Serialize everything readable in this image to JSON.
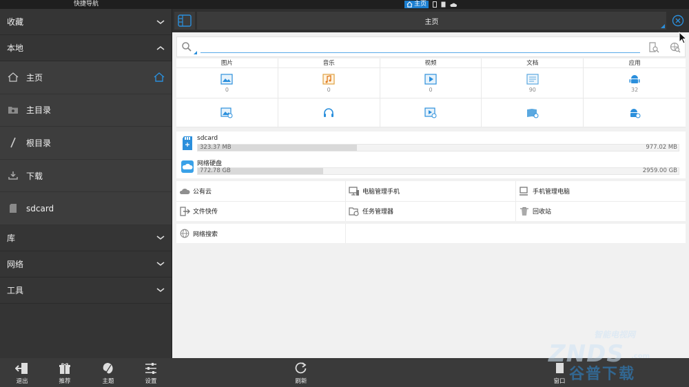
{
  "status_bar": {
    "left_title": "快捷导航",
    "active_tab": "主页"
  },
  "sidebar": {
    "sections_top": [
      {
        "label": "收藏",
        "expanded": false
      },
      {
        "label": "本地",
        "expanded": true
      }
    ],
    "local_items": [
      {
        "label": "主页",
        "icon": "home-icon",
        "active": true
      },
      {
        "label": "主目录",
        "icon": "folder-icon"
      },
      {
        "label": "根目录",
        "icon": "slash-icon"
      },
      {
        "label": "下载",
        "icon": "download-icon"
      },
      {
        "label": "sdcard",
        "icon": "sdcard-icon"
      }
    ],
    "sections_bottom": [
      {
        "label": "库"
      },
      {
        "label": "网络"
      },
      {
        "label": "工具"
      }
    ]
  },
  "bottom_bar": {
    "exit": "退出",
    "recommend": "推荐",
    "theme": "主题",
    "settings": "设置",
    "refresh": "刷新",
    "window": "窗口"
  },
  "main": {
    "title": "主页",
    "search": {
      "value": "",
      "placeholder": ""
    },
    "categories": [
      {
        "label": "图片",
        "count": "0",
        "icon": "image-icon"
      },
      {
        "label": "音乐",
        "count": "0",
        "icon": "music-icon"
      },
      {
        "label": "视频",
        "count": "0",
        "icon": "video-icon"
      },
      {
        "label": "文档",
        "count": "90",
        "icon": "document-icon"
      },
      {
        "label": "应用",
        "count": "32",
        "icon": "android-icon"
      }
    ],
    "storage": [
      {
        "name": "sdcard",
        "used": "323.37 MB",
        "total": "977.02 MB",
        "fill_fraction": 0.331,
        "icon": "sdcard-icon"
      },
      {
        "name": "网络硬盘",
        "used": "772.78 GB",
        "total": "2959.00 GB",
        "fill_fraction": 0.261,
        "icon": "cloud-drive-icon"
      }
    ],
    "tools": [
      {
        "label": "公有云",
        "icon": "cloud-icon"
      },
      {
        "label": "电脑管理手机",
        "icon": "pc-manage-phone-icon"
      },
      {
        "label": "手机管理电脑",
        "icon": "phone-manage-pc-icon"
      },
      {
        "label": "文件快传",
        "icon": "file-transfer-icon"
      },
      {
        "label": "任务管理器",
        "icon": "task-manager-icon"
      },
      {
        "label": "回收站",
        "icon": "trash-icon"
      }
    ],
    "net_search": {
      "label": "网络搜索",
      "icon": "globe-icon"
    }
  },
  "watermark": {
    "line1": "智能电视网",
    "line2": "ZNDS",
    "line3": ".com",
    "line4": "谷普下载"
  },
  "colors": {
    "accent": "#2b8fdc",
    "sidebar_bg": "#343434",
    "main_bg": "#f1f1f1"
  }
}
